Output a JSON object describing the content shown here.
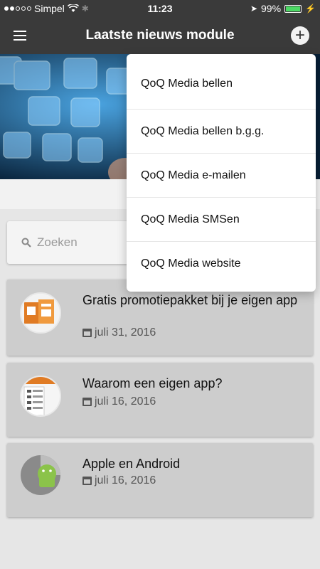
{
  "status_bar": {
    "carrier": "Simpel",
    "time": "11:23",
    "battery": "99%",
    "battery_level": 0.99
  },
  "header": {
    "title": "Laatste nieuws module",
    "add_label": "+"
  },
  "search": {
    "placeholder": "Zoeken"
  },
  "dropdown": {
    "items": [
      {
        "label": "QoQ Media bellen"
      },
      {
        "label": "QoQ Media bellen b.g.g."
      },
      {
        "label": "QoQ Media e-mailen"
      },
      {
        "label": "QoQ Media SMSen"
      },
      {
        "label": "QoQ Media website"
      }
    ]
  },
  "news": [
    {
      "title": "Gratis promotiepakket bij je eigen app",
      "date": "juli 31, 2016",
      "thumb_icon": "promo-package-thumbnail"
    },
    {
      "title": "Waarom een eigen app?",
      "date": "juli 16, 2016",
      "thumb_icon": "app-screenshot-thumbnail"
    },
    {
      "title": "Apple en Android",
      "date": "juli 16, 2016",
      "thumb_icon": "android-logo-thumbnail"
    }
  ],
  "colors": {
    "header_bg": "#3a3a3a",
    "card_bg": "#cdcdcd",
    "page_bg": "#e6e6e6"
  }
}
